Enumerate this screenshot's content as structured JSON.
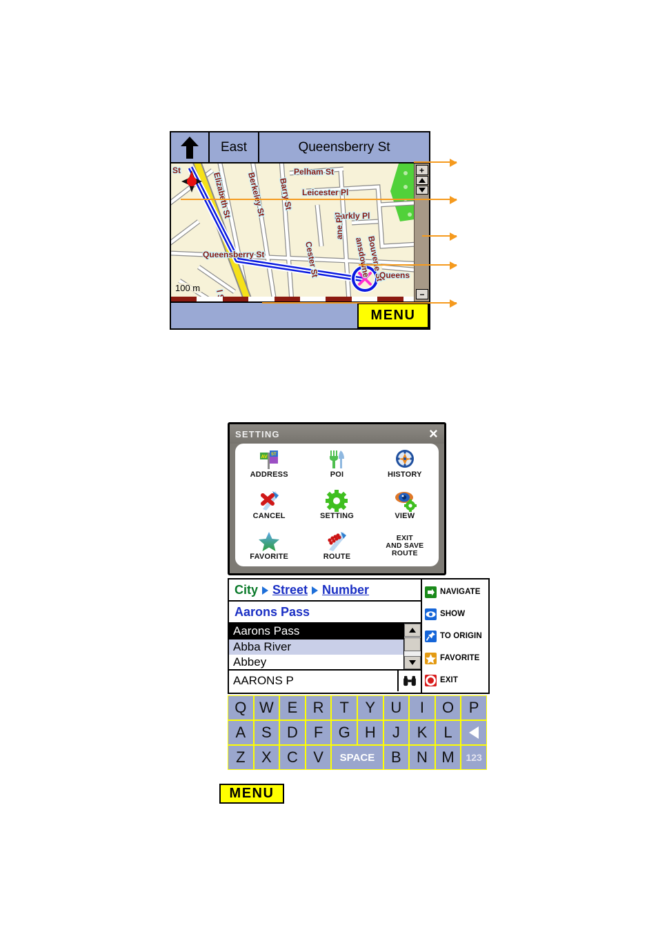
{
  "map_screen": {
    "header": {
      "direction_icon": "up-arrow-icon",
      "direction": "East",
      "street": "Queensberry St"
    },
    "scale_label": "100 m",
    "street_labels": [
      "St",
      "Elizabeth St",
      "Berkeley St",
      "Barry St",
      "Leicester Pl",
      "Barkly Pl",
      "Bouverie St",
      "Lansdowne Pl",
      "Cester St",
      "Queensberry St",
      "Queens",
      "Pelham St",
      "l St"
    ],
    "zoom_controls": {
      "zoom_in": "+",
      "zoom_out": "−",
      "scroll_up": "up-triangle-icon",
      "scroll_down": "down-triangle-icon"
    },
    "menu_label": "MENU",
    "markers": {
      "current_position": "red-position-marker",
      "destination": "destination-x-marker"
    },
    "colors": {
      "land": "#f7f2d8",
      "park": "#51d13a",
      "route": "#0a1ae0",
      "highway": "#f5e11a",
      "label_text": "#8b1a10",
      "header_bg": "#9aa9d4",
      "menu_yellow": "#ffff00",
      "callout": "#f59a1e",
      "scale_bar": "#8b1a10"
    }
  },
  "setting_panel": {
    "title": "SETTING",
    "close_label": "×",
    "items": [
      {
        "label": "ADDRESS",
        "icon": "address-sign-icon"
      },
      {
        "label": "POI",
        "icon": "fork-knife-icon"
      },
      {
        "label": "HISTORY",
        "icon": "compass-clock-icon"
      },
      {
        "label": "CANCEL",
        "icon": "red-cross-icon"
      },
      {
        "label": "SETTING",
        "icon": "green-gear-icon"
      },
      {
        "label": "VIEW",
        "icon": "eye-gear-icon"
      },
      {
        "label": "FAVORITE",
        "icon": "star-icon"
      },
      {
        "label": "ROUTE",
        "icon": "route-dots-icon"
      },
      {
        "label": "EXIT\nAND SAVE\nROUTE",
        "icon": ""
      }
    ]
  },
  "search_panel": {
    "breadcrumb": {
      "city": "City",
      "street": "Street",
      "number": "Number"
    },
    "query_value": "Aarons Pass",
    "results": [
      {
        "text": "Aarons Pass",
        "state": "selected"
      },
      {
        "text": "Abba River",
        "state": "hover"
      },
      {
        "text": "Abbey",
        "state": "normal"
      }
    ],
    "input_value": "AARONS P",
    "search_icon": "binoculars-icon"
  },
  "action_buttons": [
    {
      "label": "NAVIGATE",
      "icon": "green-arrow-icon",
      "color": "#1a8a1a"
    },
    {
      "label": "SHOW",
      "icon": "eye-icon",
      "color": "#1565d8"
    },
    {
      "label": "TO ORIGIN",
      "icon": "pin-icon",
      "color": "#1565d8"
    },
    {
      "label": "FAVORITE",
      "icon": "star-icon",
      "color": "#e39a12"
    },
    {
      "label": "EXIT",
      "icon": "stop-icon",
      "color": "#d81a1a"
    }
  ],
  "keyboard": {
    "row1": [
      "Q",
      "W",
      "E",
      "R",
      "T",
      "Y",
      "U",
      "I",
      "O",
      "P"
    ],
    "row2": [
      "A",
      "S",
      "D",
      "F",
      "G",
      "H",
      "J",
      "K",
      "L"
    ],
    "backspace": "backspace-icon",
    "row3a": [
      "Z",
      "X",
      "C",
      "V"
    ],
    "space": "SPACE",
    "row3b": [
      "B",
      "N",
      "M"
    ],
    "numeric": "123"
  },
  "bottom_menu": {
    "label": "MENU"
  }
}
